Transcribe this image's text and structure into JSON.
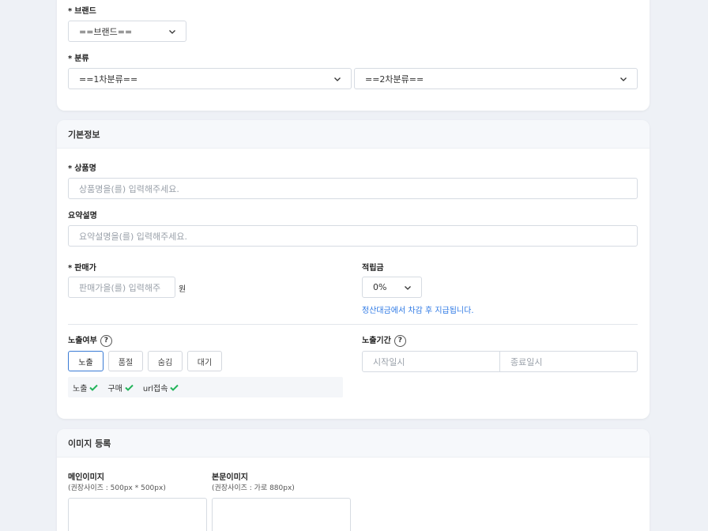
{
  "brand": {
    "label": "브랜드",
    "star": "*",
    "selected": "==브랜드=="
  },
  "category": {
    "label": "분류",
    "star": "*",
    "first": "==1차분류==",
    "second": "==2차분류=="
  },
  "basic_info": {
    "title": "기본정보",
    "product_name": {
      "star": "*",
      "label": "상품명",
      "placeholder": "상품명을(를) 입력해주세요."
    },
    "summary": {
      "label": "요약설명",
      "placeholder": "요약설명을(를) 입력해주세요."
    },
    "price": {
      "star": "*",
      "label": "판매가",
      "placeholder": "판매가을(를) 입력해주",
      "unit": "원"
    },
    "points": {
      "label": "적립금",
      "selected": "0%",
      "note": "정산대금에서 차감 후 지급됩니다."
    },
    "exposure": {
      "label": "노출여부",
      "help": "?",
      "buttons": [
        "노출",
        "품절",
        "숨김",
        "대기"
      ],
      "active": "노출",
      "status": [
        "노출",
        "구매",
        "url접속"
      ]
    },
    "period": {
      "label": "노출기간",
      "help": "?",
      "start_placeholder": "시작일시",
      "end_placeholder": "종료일시"
    }
  },
  "image_reg": {
    "title": "이미지 등록",
    "main": {
      "label": "메인이미지",
      "note": "(권장사이즈 : 500px * 500px)"
    },
    "body": {
      "label": "본문이미지",
      "note": "(권장사이즈 : 가로 880px)"
    }
  },
  "colors": {
    "accent": "#2f7ae5",
    "check": "#22b45a",
    "border": "#d6dbe2"
  },
  "icons": {
    "select_arrow": "chevron-down-icon",
    "check": "check-icon",
    "help": "question-circle-icon"
  }
}
